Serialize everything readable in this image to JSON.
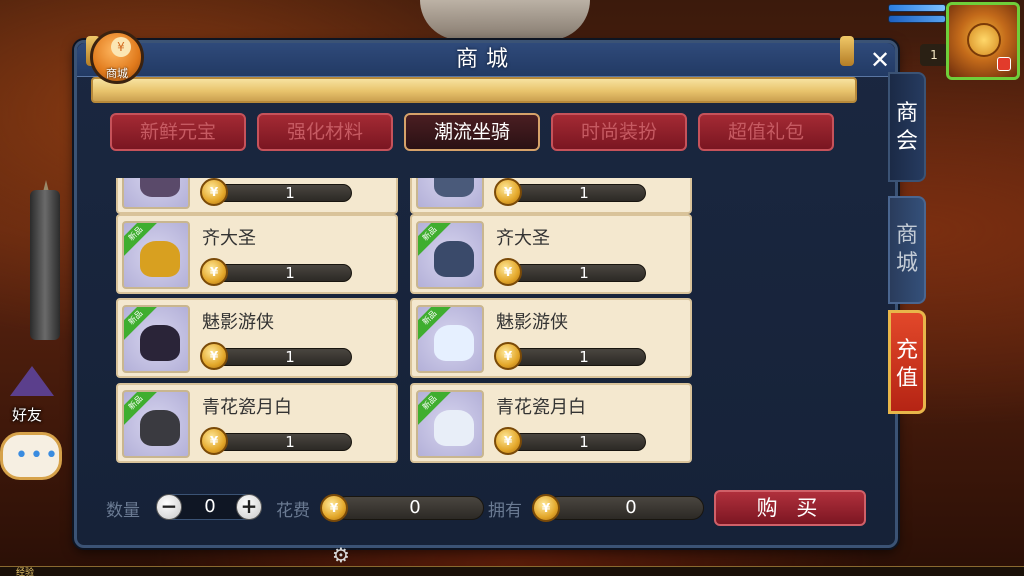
{
  "shop_badge": {
    "label": "商城",
    "icon": "yen-coin-icon"
  },
  "panel": {
    "title": "商城"
  },
  "hud": {
    "level": "1"
  },
  "tabs": [
    {
      "label": "新鲜元宝",
      "active": false
    },
    {
      "label": "强化材料",
      "active": false
    },
    {
      "label": "潮流坐骑",
      "active": true
    },
    {
      "label": "时尚装扮",
      "active": false
    },
    {
      "label": "超值礼包",
      "active": false
    }
  ],
  "items": [
    {
      "name": "",
      "price": "1",
      "badge": "",
      "color": "#5a4a6a"
    },
    {
      "name": "",
      "price": "1",
      "badge": "",
      "color": "#4a5a7a"
    },
    {
      "name": "齐大圣",
      "price": "1",
      "badge": "新品",
      "color": "#d8a020"
    },
    {
      "name": "齐大圣",
      "price": "1",
      "badge": "新品",
      "color": "#3a4a6a"
    },
    {
      "name": "魅影游侠",
      "price": "1",
      "badge": "新品",
      "color": "#2a2438"
    },
    {
      "name": "魅影游侠",
      "price": "1",
      "badge": "新品",
      "color": "#e6f0ff"
    },
    {
      "name": "青花瓷月白",
      "price": "1",
      "badge": "新品",
      "color": "#3a3a40"
    },
    {
      "name": "青花瓷月白",
      "price": "1",
      "badge": "新品",
      "color": "#e8eef8"
    }
  ],
  "side_tabs": {
    "guild": "商会",
    "shop": "商城",
    "recharge": "充值"
  },
  "footer": {
    "qty_label": "数量",
    "qty_value": "0",
    "cost_label": "花费",
    "cost_value": "0",
    "own_label": "拥有",
    "own_value": "0",
    "buy_label": "购 买"
  },
  "left": {
    "friend_label": "好友",
    "chat_label": "•••"
  },
  "exp_label": "经验"
}
